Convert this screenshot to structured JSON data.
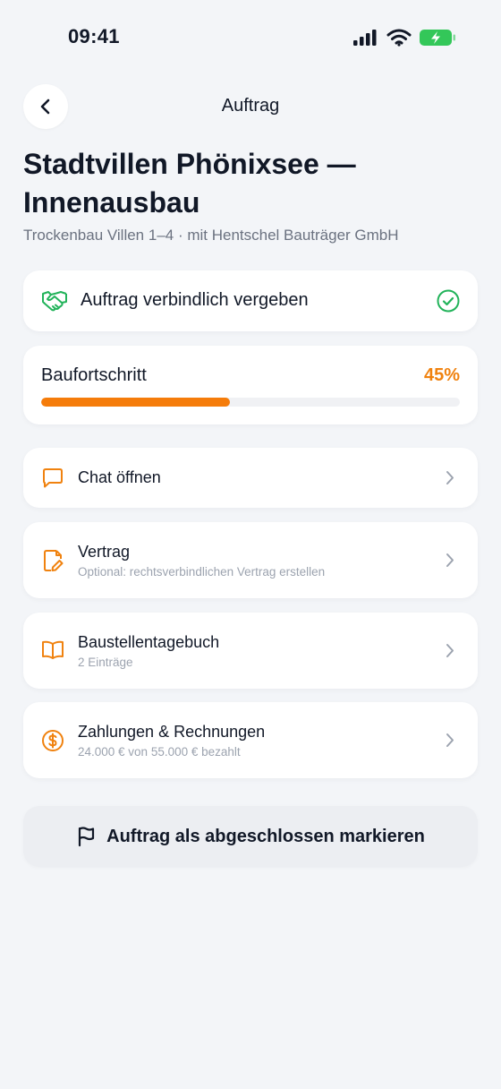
{
  "status_bar": {
    "time": "09:41"
  },
  "nav": {
    "title": "Auftrag"
  },
  "header": {
    "title": "Stadtvillen Phönixsee — Innenausbau",
    "subtitle": "Trockenbau Villen 1–4 · mit Hentschel Bauträger GmbH"
  },
  "status_card": {
    "label": "Auftrag verbindlich vergeben"
  },
  "progress": {
    "label": "Baufortschritt",
    "value_text": "45%",
    "value": 0.45
  },
  "menu": {
    "chat": {
      "title": "Chat öffnen"
    },
    "contract": {
      "title": "Vertrag",
      "subtitle": "Optional: rechtsverbindlichen Vertrag erstellen"
    },
    "diary": {
      "title": "Baustellentagebuch",
      "subtitle": "2 Einträge"
    },
    "payments": {
      "title": "Zahlungen & Rechnungen",
      "subtitle": "24.000 € von 55.000 € bezahlt"
    }
  },
  "complete_button": {
    "label": "Auftrag als abgeschlossen markieren"
  },
  "colors": {
    "accent": "#f57c0a",
    "success": "#22b35a",
    "text": "#111827",
    "muted": "#9ca3af"
  }
}
